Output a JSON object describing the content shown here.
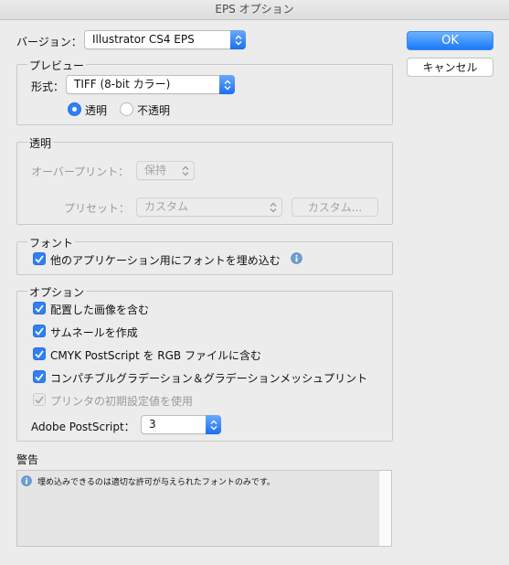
{
  "window": {
    "title": "EPS オプション"
  },
  "version": {
    "label": "バージョン：",
    "value": "Illustrator CS4 EPS"
  },
  "buttons": {
    "ok": "OK",
    "cancel": "キャンセル"
  },
  "preview": {
    "legend": "プレビュー",
    "format_label": "形式：",
    "format_value": "TIFF (8-bit カラー)",
    "transparent_label": "透明",
    "opaque_label": "不透明",
    "selected": "transparent"
  },
  "transparency": {
    "legend": "透明",
    "overprint_label": "オーバープリント：",
    "overprint_value": "保持",
    "preset_label": "プリセット：",
    "preset_value": "カスタム",
    "custom_button": "カスタム..."
  },
  "fonts": {
    "legend": "フォント",
    "embed_label": "他のアプリケーション用にフォントを埋め込む",
    "embed_checked": true
  },
  "options": {
    "legend": "オプション",
    "items": [
      {
        "label": "配置した画像を含む",
        "checked": true,
        "enabled": true
      },
      {
        "label": "サムネールを作成",
        "checked": true,
        "enabled": true
      },
      {
        "label": "CMYK PostScript を RGB ファイルに含む",
        "checked": true,
        "enabled": true
      },
      {
        "label": "コンパチブルグラデーション＆グラデーションメッシュプリント",
        "checked": true,
        "enabled": true
      },
      {
        "label": "プリンタの初期設定値を使用",
        "checked": true,
        "enabled": false
      }
    ],
    "postscript_label": "Adobe PostScript：",
    "postscript_value": "3"
  },
  "warning": {
    "title": "警告",
    "message": "埋め込みできるのは適切な許可が与えられたフォントのみです。"
  },
  "colors": {
    "accent": "#2f7ff6",
    "background": "#ececec"
  }
}
